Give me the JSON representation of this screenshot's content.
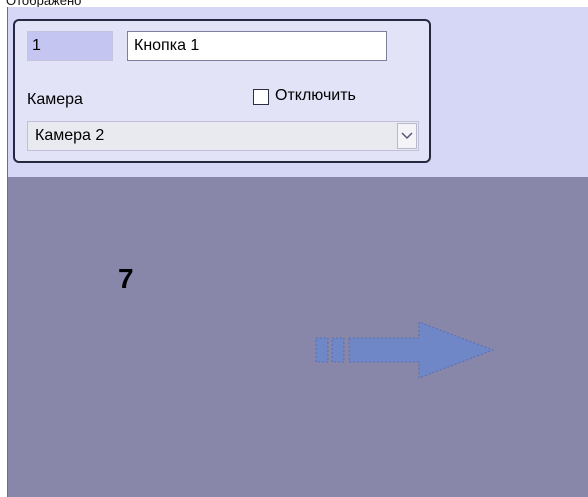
{
  "header": {
    "cut_text": "Отображено"
  },
  "panel": {
    "id_value": "1",
    "name_value": "Кнопка 1",
    "camera_label": "Камера",
    "disable_label": "Отключить",
    "disable_checked": false,
    "camera_selected": "Камера 2"
  },
  "preview": {
    "number": "7",
    "arrow_icon": "arrow-right-icon"
  },
  "colors": {
    "upper_background": "#d6d6f7",
    "preview_background": "#8887a9",
    "arrow_color": "#6f86c7"
  }
}
